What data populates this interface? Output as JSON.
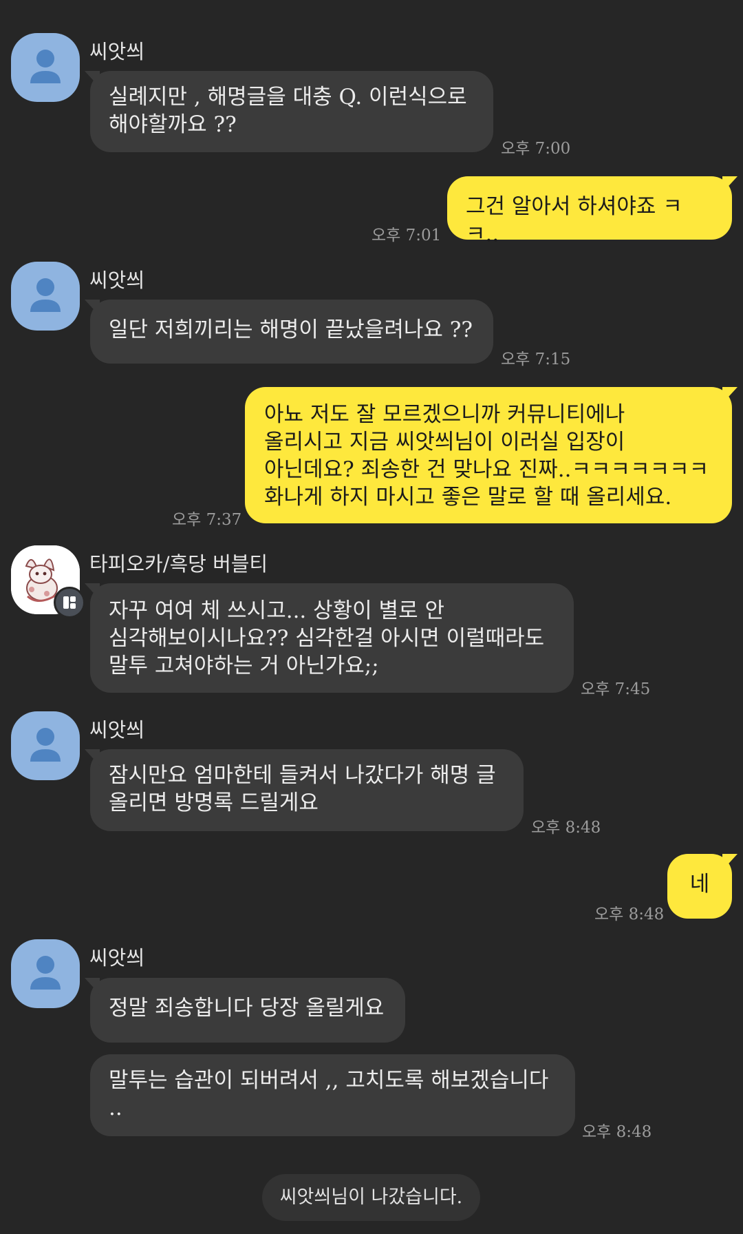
{
  "chat": {
    "messages": [
      {
        "sender": "씨앗씌",
        "text": "실례지만 , 해명글을 대충 Q. 이런식으로\n해야할까요 ??",
        "time": "오후 7:00"
      },
      {
        "text": "그건 알아서 하셔야죠 ㅋㅋ..",
        "time": "오후 7:01"
      },
      {
        "sender": "씨앗씌",
        "text": "일단 저희끼리는 해명이 끝났을려나요 ??",
        "time": "오후 7:15"
      },
      {
        "text": "아뇨 저도 잘 모르겠으니까 커뮤니티에나\n올리시고 지금 씨앗씌님이 이러실 입장이\n아닌데요? 죄송한 건 맞나요 진짜..ㅋㅋㅋㅋㅋㅋㅋ\n화나게 하지 마시고 좋은 말로 할 때 올리세요.",
        "time": "오후 7:37"
      },
      {
        "sender": "타피오카/흑당 버블티",
        "text": "자꾸 여여 체 쓰시고... 상황이 별로 안\n심각해보이시나요?? 심각한걸 아시면 이럴때라도\n말투 고쳐야하는 거 아닌가요;;",
        "time": "오후 7:45"
      },
      {
        "sender": "씨앗씌",
        "text": "잠시만요 엄마한테 들켜서 나갔다가 해명 글\n올리면 방명록 드릴게요",
        "time": "오후 8:48"
      },
      {
        "text": "네",
        "time": "오후 8:48"
      },
      {
        "sender": "씨앗씌",
        "text": "정말 죄송합니다 당장 올릴게요"
      },
      {
        "text": "말투는 습관이 되버려서 ,, 고치도록 해보겠습니다\n..",
        "time": "오후 8:48"
      }
    ],
    "system_notice": "씨앗씌님이 나갔습니다.",
    "colors": {
      "background": "#262626",
      "incoming_bubble": "#3b3b3b",
      "outgoing_bubble": "#fee83d",
      "default_avatar": "#8fb4e0",
      "timestamp": "#9c9c9c"
    },
    "icons": {
      "default_avatar": "person-silhouette-icon",
      "profile_badge": "profile-badge-icon"
    }
  }
}
